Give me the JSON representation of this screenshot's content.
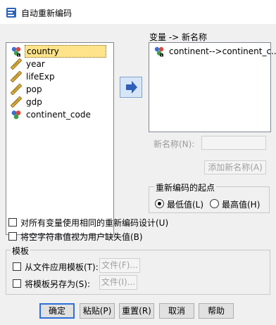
{
  "window": {
    "title": "自动重新编码"
  },
  "variables": {
    "items": [
      {
        "label": "country",
        "icon": "nominal-variable-icon"
      },
      {
        "label": "year",
        "icon": "scale-variable-icon"
      },
      {
        "label": "lifeExp",
        "icon": "scale-variable-icon"
      },
      {
        "label": "pop",
        "icon": "scale-variable-icon"
      },
      {
        "label": "gdp",
        "icon": "scale-variable-icon"
      },
      {
        "label": "continent_code",
        "icon": "nominal-numeric-icon"
      }
    ]
  },
  "mapping": {
    "header": "变量 -> 新名称",
    "items": [
      {
        "label": "continent-->continent_c...",
        "icon": "nominal-variable-icon"
      }
    ]
  },
  "new_name": {
    "label": "新名称(N):",
    "value": ""
  },
  "add_new_name_button": "添加新名称(A)",
  "start_group": {
    "title": "重新编码的起点",
    "options": [
      {
        "label": "最低值(L)",
        "selected": true
      },
      {
        "label": "最高值(H)",
        "selected": false
      }
    ]
  },
  "checkboxes": {
    "same_scheme": "对所有变量使用相同的重新编码设计(U)",
    "blank_missing": "将空字符串值视为用户缺失值(B)"
  },
  "template": {
    "title": "模板",
    "apply_label": "从文件应用模板(T):",
    "save_label": "将模板另存为(S):",
    "file_button_apply": "文件(F)...",
    "file_button_save": "文件(I)..."
  },
  "footer": {
    "ok": "确定",
    "paste": "粘贴(P)",
    "reset": "重置(R)",
    "cancel": "取消",
    "help": "帮助"
  },
  "colors": {
    "selection": "#ffe38a",
    "arrow_blue": "#2f5fb8",
    "default_border": "#2e6fd6"
  }
}
